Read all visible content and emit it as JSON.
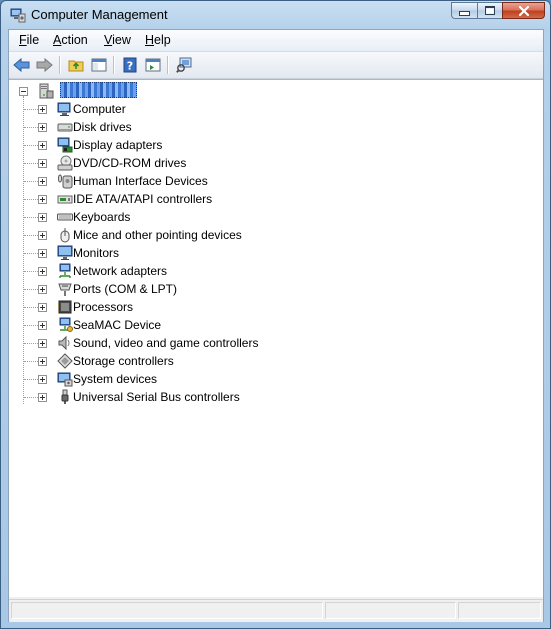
{
  "window": {
    "title": "Computer Management"
  },
  "menu": [
    {
      "id": "file",
      "label": "File"
    },
    {
      "id": "action",
      "label": "Action"
    },
    {
      "id": "view",
      "label": "View"
    },
    {
      "id": "help",
      "label": "Help"
    }
  ],
  "toolbar": {
    "buttons": [
      "back-icon",
      "forward-icon",
      "up-folder-icon",
      "show-hide-tree-icon",
      "help-icon",
      "properties-icon",
      "scan-hardware-icon"
    ]
  },
  "tree": {
    "root": {
      "label": ""
    },
    "items": [
      {
        "label": "Computer",
        "icon": "computer-icon"
      },
      {
        "label": "Disk drives",
        "icon": "disk-drive-icon"
      },
      {
        "label": "Display adapters",
        "icon": "display-adapter-icon"
      },
      {
        "label": "DVD/CD-ROM drives",
        "icon": "dvd-drive-icon"
      },
      {
        "label": "Human Interface Devices",
        "icon": "hid-icon"
      },
      {
        "label": "IDE ATA/ATAPI controllers",
        "icon": "ide-controller-icon"
      },
      {
        "label": "Keyboards",
        "icon": "keyboard-icon"
      },
      {
        "label": "Mice and other pointing devices",
        "icon": "mouse-icon"
      },
      {
        "label": "Monitors",
        "icon": "monitor-icon"
      },
      {
        "label": "Network adapters",
        "icon": "network-adapter-icon"
      },
      {
        "label": "Ports (COM & LPT)",
        "icon": "port-icon"
      },
      {
        "label": "Processors",
        "icon": "processor-icon"
      },
      {
        "label": "SeaMAC Device",
        "icon": "seamac-device-icon"
      },
      {
        "label": "Sound, video and game controllers",
        "icon": "sound-icon"
      },
      {
        "label": "Storage controllers",
        "icon": "storage-controller-icon"
      },
      {
        "label": "System devices",
        "icon": "system-devices-icon"
      },
      {
        "label": "Universal Serial Bus controllers",
        "icon": "usb-icon"
      }
    ]
  },
  "colors": {
    "accent": "#3a78d6",
    "close": "#c2401f"
  }
}
